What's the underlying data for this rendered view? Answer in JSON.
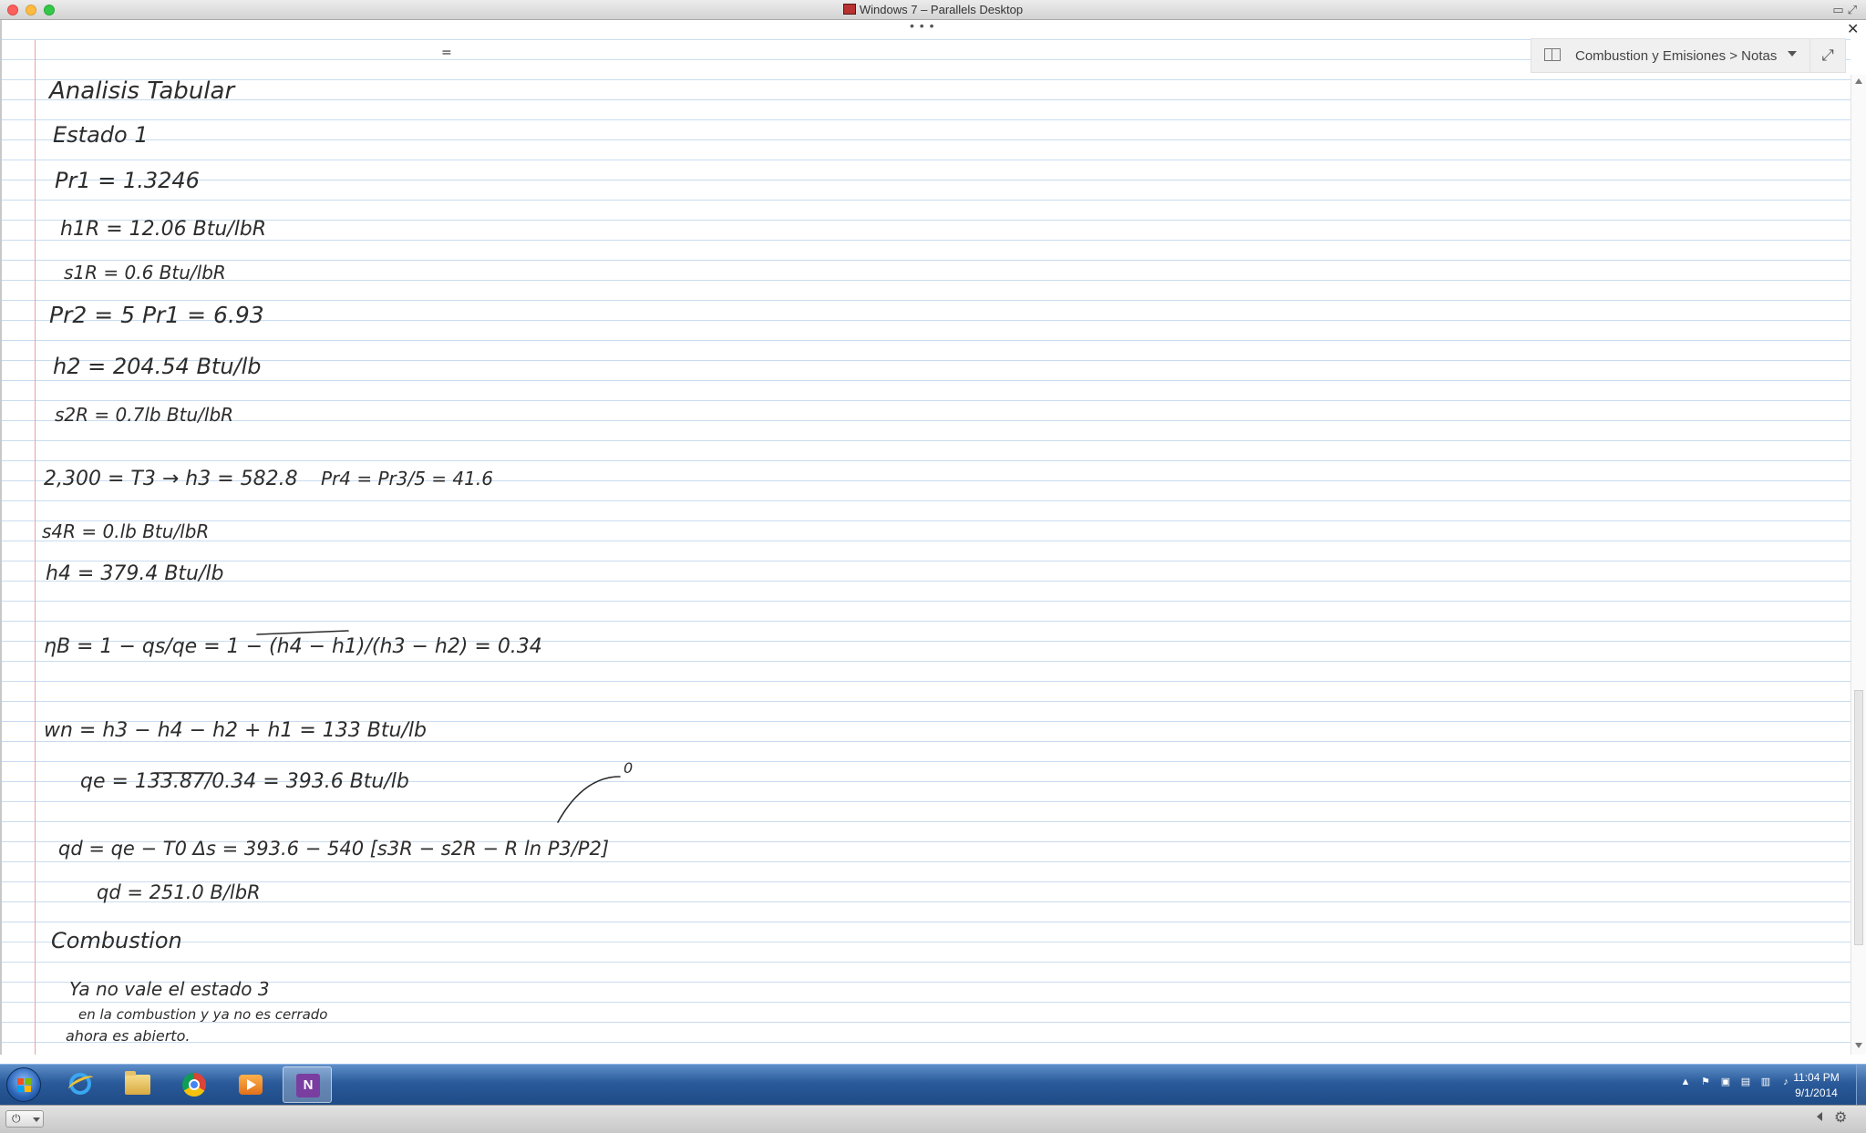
{
  "window": {
    "title": "Windows 7 – Parallels Desktop"
  },
  "onenote": {
    "breadcrumb": "Combustion y Emisiones > Notas",
    "handwritten_notes": {
      "heading": "Analisis Tabular",
      "estado": "Estado 1",
      "pr1": "Pr1 = 1.3246",
      "h1": "h1R = 12.06 Btu/lbR",
      "s1": "s1R = 0.6 Btu/lbR",
      "pr2": "Pr2 = 5 Pr1 = 6.93",
      "h2": "h2 = 204.54 Btu/lb",
      "s2": "s2R = 0.7lb Btu/lbR",
      "t3": "2,300 = T3 → h3 = 582.8",
      "pr4": "Pr4 = Pr3/5 = 41.6",
      "s4": "s4R = 0.lb Btu/lbR",
      "h4": "h4 = 379.4 Btu/lb",
      "eta": "ηB = 1 − qs/qe = 1 − (h4 − h1)/(h3 − h2) = 0.34",
      "wn": "wn = h3 − h4 − h2 + h1 = 133 Btu/lb",
      "qe": "qe = 133.87/0.34 = 393.6 Btu/lb",
      "qd": "qd = qe − T0 Δs = 393.6 − 540 [s3R − s2R − R ln P3/P2]",
      "qd_result": "qd = 251.0 B/lbR",
      "combustion_heading": "Combustion",
      "combustion_line1": "Ya no vale el estado 3",
      "combustion_line2": "en la combustion y ya no es cerrado",
      "combustion_line3": "ahora es abierto."
    }
  },
  "taskbar": {
    "pinned": [
      "start-button",
      "internet-explorer",
      "windows-explorer",
      "google-chrome",
      "media-player",
      "onenote"
    ],
    "active_app": "onenote",
    "clock_time": "11:04 PM",
    "clock_date": "9/1/2014"
  },
  "colors": {
    "rule_line": "#c9dcef",
    "margin_line": "#e8a3a3",
    "ink": "#2a2a2a",
    "taskbar": "#2a5a9a"
  }
}
